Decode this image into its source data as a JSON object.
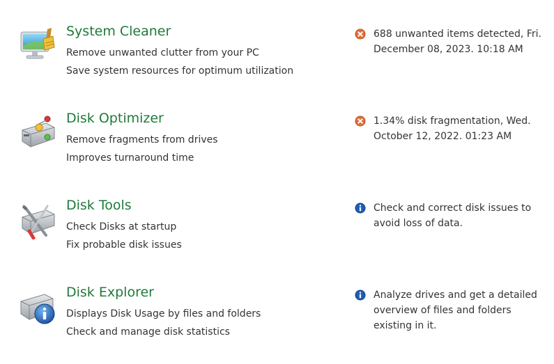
{
  "items": [
    {
      "title": "System Cleaner",
      "desc1": "Remove unwanted clutter from your PC",
      "desc2": "Save system resources for optimum utilization",
      "status_icon": "warning-icon",
      "status": "688 unwanted items detected, Fri. December 08, 2023. 10:18 AM",
      "icon": "monitor-broom-icon"
    },
    {
      "title": "Disk Optimizer",
      "desc1": "Remove fragments from drives",
      "desc2": "Improves turnaround time",
      "status_icon": "warning-icon",
      "status": "1.34% disk fragmentation, Wed. October 12, 2022. 01:23 AM",
      "icon": "disk-drive-icon"
    },
    {
      "title": "Disk Tools",
      "desc1": "Check Disks at startup",
      "desc2": "Fix probable disk issues",
      "status_icon": "info-icon",
      "status": "Check and correct disk issues to avoid loss of data.",
      "icon": "disk-tools-icon"
    },
    {
      "title": "Disk Explorer",
      "desc1": "Displays Disk Usage by files and folders",
      "desc2": "Check and manage disk statistics",
      "status_icon": "info-icon",
      "status": "Analyze drives and get a detailed overview of files and folders existing in it.",
      "icon": "disk-explorer-icon"
    }
  ],
  "colors": {
    "title": "#1f7a3a",
    "warning": "#e0703a",
    "info": "#1f5fb5"
  }
}
